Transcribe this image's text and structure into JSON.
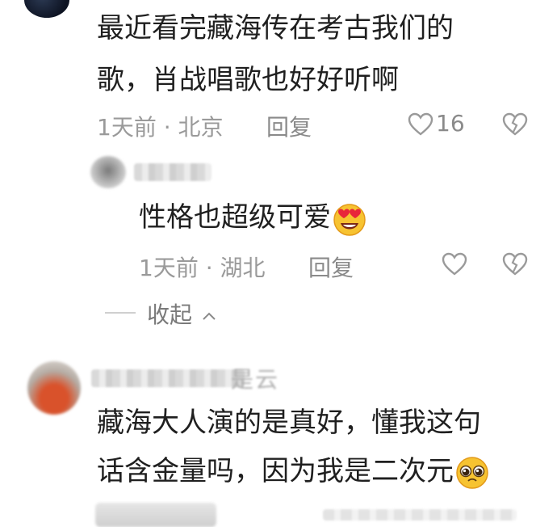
{
  "comment1": {
    "line1": "最近看完藏海传在考古我们的",
    "line2": "歌，肖战唱歌也好好听啊",
    "time": "1天前",
    "location": "北京",
    "reply_label": "回复",
    "like_count": "16"
  },
  "reply1": {
    "text": "性格也超级可爱",
    "emoji_icon": "heart-eyes-emoji",
    "time": "1天前",
    "location": "湖北",
    "reply_label": "回复"
  },
  "collapse": {
    "label": "收起"
  },
  "comment2": {
    "author": "是云",
    "line1": "藏海大人演的是真好，懂我这句",
    "line2": "话含金量吗，因为我是二次元",
    "emoji_icon": "pleading-face-emoji"
  },
  "colors": {
    "text": "#1f1f1f",
    "meta": "#9a9a9a",
    "icon": "#9a9a9a",
    "background": "#ffffff"
  }
}
